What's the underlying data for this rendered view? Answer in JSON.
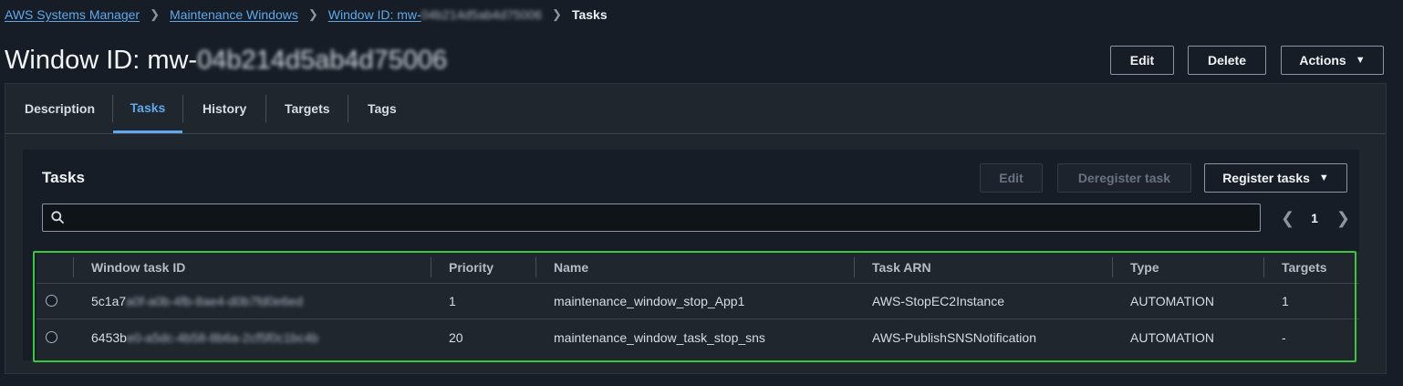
{
  "breadcrumb": {
    "items": [
      "AWS Systems Manager",
      "Maintenance Windows"
    ],
    "window_prefix": "Window ID: mw-",
    "window_redacted": "04b214d5ab4d75006",
    "current": "Tasks"
  },
  "page": {
    "title_prefix": "Window ID: mw-",
    "title_redacted": "04b214d5ab4d75006"
  },
  "header_buttons": {
    "edit": "Edit",
    "delete": "Delete",
    "actions": "Actions"
  },
  "tabs": [
    "Description",
    "Tasks",
    "History",
    "Targets",
    "Tags"
  ],
  "active_tab": "Tasks",
  "tasks": {
    "title": "Tasks",
    "edit_label": "Edit",
    "deregister_label": "Deregister task",
    "register_label": "Register tasks",
    "search_placeholder": "",
    "page_number": "1",
    "columns": [
      "Window task ID",
      "Priority",
      "Name",
      "Task ARN",
      "Type",
      "Targets"
    ],
    "rows": [
      {
        "id_prefix": "5c1a7",
        "id_redacted": "a0f-a0b-4fb-8ae4-d0b7fd0e6ed",
        "priority": "1",
        "name": "maintenance_window_stop_App1",
        "arn": "AWS-StopEC2Instance",
        "type": "AUTOMATION",
        "targets": "1"
      },
      {
        "id_prefix": "6453b",
        "id_redacted": "e0-a5dc-4b58-8b6a-2cf5f0c1bc4b",
        "priority": "20",
        "name": "maintenance_window_task_stop_sns",
        "arn": "AWS-PublishSNSNotification",
        "type": "AUTOMATION",
        "targets": "-"
      }
    ]
  },
  "colors": {
    "background": "#161d26",
    "panel": "#20262e",
    "link": "#5fa8ea",
    "highlight": "#3ec43e"
  }
}
